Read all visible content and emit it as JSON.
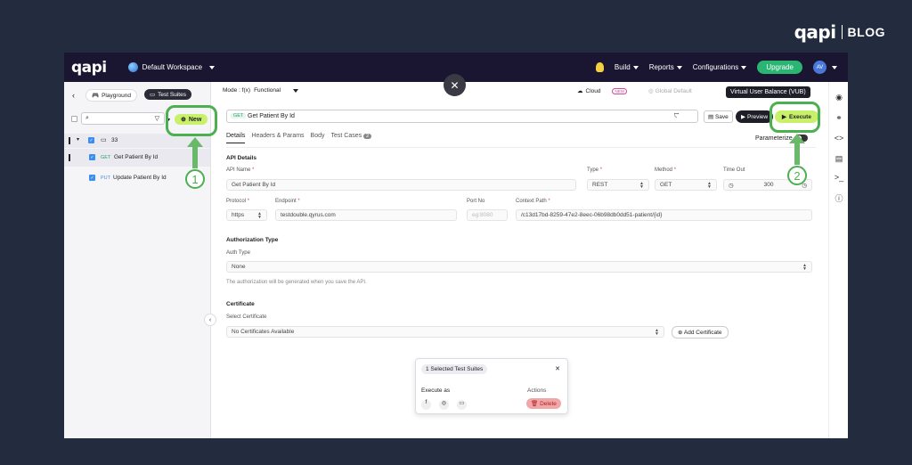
{
  "brand": {
    "logo": "qapi",
    "blog": "BLOG"
  },
  "topbar": {
    "logo": "qapi",
    "workspace": "Default Workspace",
    "nav": [
      "Build",
      "Reports",
      "Configurations"
    ],
    "upgrade": "Upgrade",
    "avatar": "AV"
  },
  "sidebar": {
    "tabs": {
      "playground": "Playground",
      "test_suites": "Test Suites"
    },
    "new_label": "New",
    "folder": "33",
    "items": [
      {
        "method": "GET",
        "label": "Get Patient By Id"
      },
      {
        "method": "PUT",
        "label": "Update Patient By Id"
      }
    ]
  },
  "header": {
    "mode_label": "Mode : f(x)",
    "mode_value": "Functional",
    "cloud": "Cloud",
    "new_badge": "NEW",
    "global_default": "Global Default",
    "tooltip": "Virtual User Balance (VUB)"
  },
  "api_bar": {
    "method": "GET",
    "name": "Get Patient By Id",
    "save": "Save",
    "preview": "Preview",
    "execute": "Execute"
  },
  "tabs": [
    {
      "label": "Details"
    },
    {
      "label": "Headers & Params"
    },
    {
      "label": "Body"
    },
    {
      "label": "Test Cases",
      "badge": "2"
    }
  ],
  "parameterize": "Parameterize",
  "api_details": {
    "section": "API Details",
    "api_name_label": "API Name",
    "api_name_value": "Get Patient By Id",
    "type_label": "Type",
    "type_value": "REST",
    "method_label": "Method",
    "method_value": "GET",
    "timeout_label": "Time Out",
    "timeout_value": "300",
    "protocol_label": "Protocol",
    "protocol_value": "https",
    "endpoint_label": "Endpoint",
    "endpoint_value": "testdouble.qyrus.com",
    "port_label": "Port No",
    "port_placeholder": "eg:8080",
    "context_label": "Context Path",
    "context_value": "/c13d17bd-8259-47e2-8eec-06b98db0dd51-patient/{id}"
  },
  "authorization": {
    "section": "Authorization Type",
    "auth_type_label": "Auth Type",
    "value": "None",
    "hint": "The authorization will be generated when you save the API."
  },
  "certificate": {
    "section": "Certificate",
    "select_label": "Select Certificate",
    "value": "No Certificates Available",
    "add": "Add Certificate"
  },
  "popup": {
    "title": "1 Selected Test Suites",
    "execute_as": "Execute as",
    "actions": "Actions",
    "delete": "Delete"
  },
  "annotations": {
    "one": "1",
    "two": "2"
  },
  "colors": {
    "accent": "#c8f06a",
    "annotation": "#4caf50",
    "topbar": "#1a1530",
    "background": "#232b3e"
  }
}
